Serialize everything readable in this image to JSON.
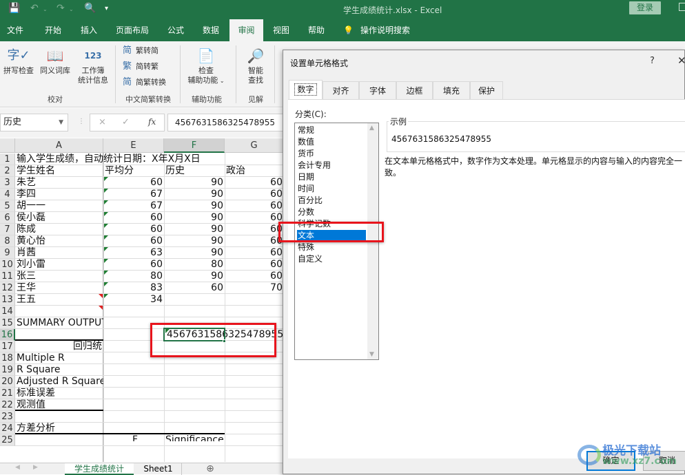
{
  "titlebar": {
    "doc_title": "学生成绩统计.xlsx  -  Excel",
    "login_label": "登录",
    "quick_access": [
      "save-icon",
      "undo-icon",
      "redo-icon",
      "print-preview-icon",
      "customize-icon"
    ]
  },
  "ribbon_tabs": [
    {
      "label": "文件"
    },
    {
      "label": "开始"
    },
    {
      "label": "插入"
    },
    {
      "label": "页面布局"
    },
    {
      "label": "公式"
    },
    {
      "label": "数据"
    },
    {
      "label": "审阅",
      "active": true
    },
    {
      "label": "视图"
    },
    {
      "label": "帮助"
    }
  ],
  "tell_me": "操作说明搜索",
  "ribbon": {
    "proofing": {
      "spelling": "拼写检查",
      "thesaurus": "同义词库",
      "stats_line1": "工作簿",
      "stats_line2": "统计信息",
      "group": "校对"
    },
    "chinese": {
      "t2s": "繁转简",
      "s2t": "简转繁",
      "convert": "简繁转换",
      "group": "中文简繁转换"
    },
    "accessibility": {
      "line1": "检查",
      "line2": "辅助功能",
      "group": "辅助功能"
    },
    "insights": {
      "line1": "智能",
      "line2": "查找",
      "group": "见解"
    }
  },
  "formula_bar": {
    "name_box": "历史",
    "cancel": "×",
    "enter": "✓",
    "fx": "fx",
    "value": "4567631586325478955"
  },
  "sheet": {
    "columns": [
      "A",
      "E",
      "F",
      "G"
    ],
    "selected_column": "F",
    "selected_row": "16",
    "rows": [
      {
        "n": "1",
        "A": "输入学生成绩，自动统计日期：X年X月X日"
      },
      {
        "n": "2",
        "A": "学生姓名",
        "E": "平均分",
        "F": "历史",
        "G": "政治"
      },
      {
        "n": "3",
        "A": "朱艺",
        "E": "60",
        "F": "90",
        "G": "60"
      },
      {
        "n": "4",
        "A": "李四",
        "E": "67",
        "F": "90",
        "G": "60"
      },
      {
        "n": "5",
        "A": "胡一一",
        "E": "67",
        "F": "90",
        "G": "60"
      },
      {
        "n": "6",
        "A": "侯小磊",
        "E": "60",
        "F": "90",
        "G": "60"
      },
      {
        "n": "7",
        "A": "陈成",
        "E": "60",
        "F": "90",
        "G": "60"
      },
      {
        "n": "8",
        "A": "黄心怡",
        "E": "60",
        "F": "90",
        "G": "60"
      },
      {
        "n": "9",
        "A": "肖茜",
        "E": "63",
        "F": "90",
        "G": "60"
      },
      {
        "n": "10",
        "A": "刘小雷",
        "E": "60",
        "F": "80",
        "G": "60"
      },
      {
        "n": "11",
        "A": "张三",
        "E": "80",
        "F": "90",
        "G": "60"
      },
      {
        "n": "12",
        "A": "王华",
        "E": "83",
        "F": "60",
        "G": "70"
      },
      {
        "n": "13",
        "A": "王五",
        "E": "34"
      },
      {
        "n": "14"
      },
      {
        "n": "15",
        "A": "SUMMARY OUTPUT"
      },
      {
        "n": "16",
        "F": "4567631586325478955"
      },
      {
        "n": "17",
        "A": "回归统"
      },
      {
        "n": "18",
        "A": "Multiple R"
      },
      {
        "n": "19",
        "A": "R Square"
      },
      {
        "n": "20",
        "A": "Adjusted R Square"
      },
      {
        "n": "21",
        "A": "标准误差"
      },
      {
        "n": "22",
        "A": "观测值"
      },
      {
        "n": "23"
      },
      {
        "n": "24",
        "A": "方差分析"
      },
      {
        "n": "25",
        "E": "F",
        "F": "Significance F"
      }
    ]
  },
  "sheet_tabs": [
    {
      "label": "学生成绩统计",
      "active": true
    },
    {
      "label": "Sheet1"
    }
  ],
  "add_sheet": "⊕",
  "dialog": {
    "title": "设置单元格格式",
    "help": "?",
    "close": "✕",
    "tabs": [
      {
        "label": "数字",
        "active": true
      },
      {
        "label": "对齐"
      },
      {
        "label": "字体"
      },
      {
        "label": "边框"
      },
      {
        "label": "填充"
      },
      {
        "label": "保护"
      }
    ],
    "category_label": "分类(C):",
    "categories": [
      "常规",
      "数值",
      "货币",
      "会计专用",
      "日期",
      "时间",
      "百分比",
      "分数",
      "科学记数",
      "文本",
      "特殊",
      "自定义"
    ],
    "selected_category": "文本",
    "sample_label": "示例",
    "sample_value": "4567631586325478955",
    "description": "在文本单元格格式中，数字作为文本处理。单元格显示的内容与输入的内容完全一致。",
    "ok": "确定",
    "cancel": "取消"
  },
  "watermark": {
    "name": "极光下载站",
    "url": "www.xz7.com"
  },
  "colors": {
    "excel_green": "#217346",
    "selection_blue": "#0078d7",
    "highlight_red": "#e8141c"
  }
}
